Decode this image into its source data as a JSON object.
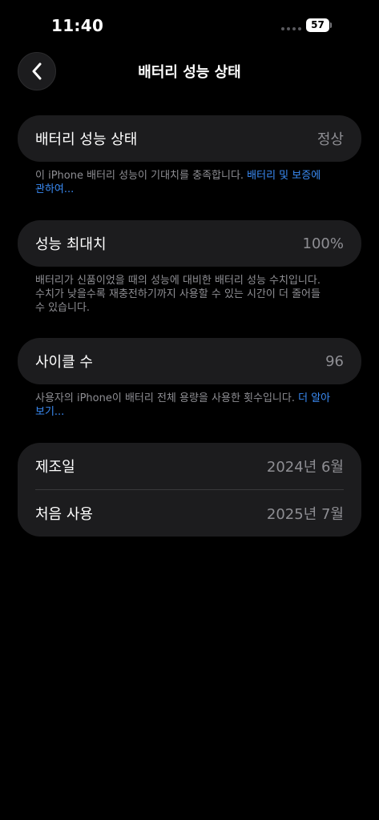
{
  "status_bar": {
    "time": "11:40",
    "battery_level": "57"
  },
  "nav": {
    "title": "배터리 성능 상태"
  },
  "health_card": {
    "label": "배터리 성능 상태",
    "value": "정상"
  },
  "health_footnote": {
    "text": "이 iPhone 배터리 성능이 기대치를 충족합니다. ",
    "link": "배터리 및 보증에 관하여..."
  },
  "capacity_card": {
    "label": "성능 최대치",
    "value": "100%"
  },
  "capacity_footnote": {
    "text": "배터리가 신품이었을 때의 성능에 대비한 배터리 성능 수치입니다. 수치가 낮을수록 재충전하기까지 사용할 수 있는 시간이 더 줄어들 수 있습니다."
  },
  "cycle_card": {
    "label": "사이클 수",
    "value": "96"
  },
  "cycle_footnote": {
    "text": "사용자의 iPhone이 배터리 전체 용량을 사용한 횟수입니다. ",
    "link": "더 알아보기..."
  },
  "dates_card": {
    "manufacture_label": "제조일",
    "manufacture_value": "2024년 6월",
    "first_use_label": "처음 사용",
    "first_use_value": "2025년 7월"
  },
  "colors": {
    "background": "#000000",
    "card": "#1c1c1e",
    "secondary_text": "#8e8e93",
    "link": "#3a8bf5"
  },
  "icons": {
    "back": "chevron-left-icon",
    "signal": "cellular-signal-icon",
    "battery": "battery-icon"
  }
}
